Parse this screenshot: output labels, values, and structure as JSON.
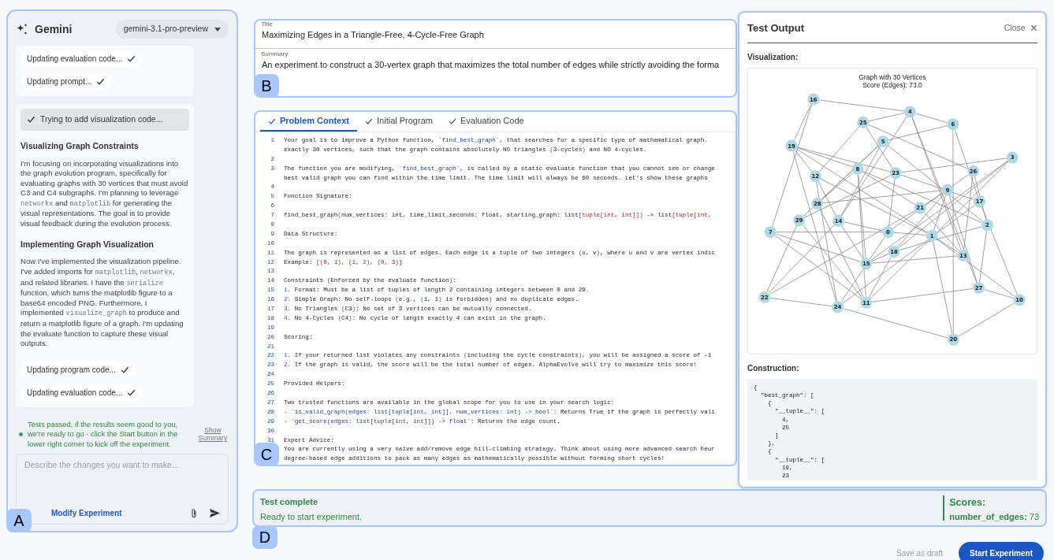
{
  "assistant": {
    "name": "Gemini",
    "model": "gemini-3.1-pro-preview",
    "messages": [
      {
        "kind": "steps",
        "items": [
          {
            "label": "Updating evaluation code...",
            "done": true
          },
          {
            "label": "Updating prompt...",
            "done": true
          }
        ]
      },
      {
        "kind": "thought",
        "status": {
          "label": "Trying to add visualization code...",
          "done": true
        },
        "sections": [
          {
            "heading": "Visualizing Graph Constraints",
            "body": [
              {
                "kind": "text",
                "text": "I'm focusing on incorporating visualizations into the graph evolution program, specifically for evaluating graphs with 30 vertices that must avoid C3 and C4 subgraphs. I'm planning to leverage "
              },
              {
                "kind": "code",
                "text": "networkx"
              },
              {
                "kind": "text",
                "text": " and "
              },
              {
                "kind": "code",
                "text": "matplotlib"
              },
              {
                "kind": "text",
                "text": " for generating the visual representations. The goal is to provide visual feedback during the evolution process."
              }
            ]
          },
          {
            "heading": "Implementing Graph Visualization",
            "body": [
              {
                "kind": "text",
                "text": "Now I've implemented the visualization pipeline. I've added imports for "
              },
              {
                "kind": "code",
                "text": "matplotlib"
              },
              {
                "kind": "text",
                "text": ", "
              },
              {
                "kind": "code",
                "text": "networkx"
              },
              {
                "kind": "text",
                "text": ", and related libraries. I have the "
              },
              {
                "kind": "code",
                "text": "serialize"
              },
              {
                "kind": "text",
                "text": " function, which turns the matplotlib figure to a base64 encoded PNG. Furthermore, I implemented "
              },
              {
                "kind": "code",
                "text": "visualize_graph"
              },
              {
                "kind": "text",
                "text": " to produce and return a matplotlib figure of a graph. I'm updating the evaluate function to capture these visual outputs."
              }
            ]
          }
        ],
        "items": [
          {
            "label": "Updating program code...",
            "done": true
          },
          {
            "label": "Updating evaluation code...",
            "done": true
          }
        ]
      }
    ],
    "notice": {
      "text": "Tests passed, if the results seem good to you, we're ready to go - click the Start button in the lower right corner to kick off the experiment.",
      "link": "Show Summary"
    },
    "composer": {
      "placeholder": "Describe the changes you want to make...",
      "action": "Modify Experiment"
    }
  },
  "experiment": {
    "title_label": "Title",
    "title": "Maximizing Edges in a Triangle-Free, 4-Cycle-Free Graph",
    "summary_label": "Summary",
    "summary": "An experiment to construct a 30-vertex graph that maximizes the total number of edges while strictly avoiding the forma"
  },
  "tabs": [
    {
      "label": "Problem Context",
      "selected": true,
      "done": true
    },
    {
      "label": "Initial Program",
      "selected": false,
      "done": true
    },
    {
      "label": "Evaluation Code",
      "selected": false,
      "done": true
    }
  ],
  "code_lines": [
    {
      "number": "1",
      "text": "Your goal is to improve a Python function, `find_best_graph`, that searches for a specific type of mathematical graph."
    },
    {
      "text": "exactly 30 vertices, such that the graph contains absolutely NO triangles (3-cycles) and NO 4-cycles."
    },
    {
      "number": "2"
    },
    {
      "number": "3",
      "text": "The function you are modifying, `find_best_graph`, is called by a static evaluate function that you cannot see or change"
    },
    {
      "text": "best valid graph you can find within the time limit. The time limit will always be 60 seconds. Let's show these graphs"
    },
    {
      "number": "4"
    },
    {
      "number": "5",
      "text": "Function Signature:"
    },
    {
      "number": "6"
    },
    {
      "number": "7",
      "text": "find_best_graph(num_vertices: int, time_limit_seconds: float, starting_graph: list[tuple[int, int]]) -> list[tuple[int,"
    },
    {
      "number": "8"
    },
    {
      "number": "9",
      "text": "Data Structure:"
    },
    {
      "number": "10"
    },
    {
      "number": "11",
      "text": "The graph is represented as a list of edges. Each edge is a tuple of two integers (u, v), where u and v are vertex indic"
    },
    {
      "number": "12",
      "text": "Example: [(0, 1), (1, 2), (0, 3)]"
    },
    {
      "number": "13"
    },
    {
      "number": "14",
      "text": "Constraints (Enforced by the evaluate function):"
    },
    {
      "number": "15",
      "text": "1. Format: Must be a list of tuples of length 2 containing integers between 0 and 29."
    },
    {
      "number": "16",
      "text": "2. Simple Graph: No self-loops (e.g., (1, 1) is forbidden) and no duplicate edges."
    },
    {
      "number": "17",
      "text": "3. No Triangles (C3): No set of 3 vertices can be mutually connected."
    },
    {
      "number": "18",
      "text": "4. No 4-Cycles (C4): No cycle of length exactly 4 can exist in the graph."
    },
    {
      "number": "19"
    },
    {
      "number": "20",
      "text": "Scoring:"
    },
    {
      "number": "21"
    },
    {
      "number": "22",
      "text": "1. If your returned list violates any constraints (including the cycle constraints), you will be assigned a score of -1"
    },
    {
      "number": "23",
      "text": "2. If the graph is valid, the score will be the total number of edges. AlphaEvolve will try to maximize this score!"
    },
    {
      "number": "24"
    },
    {
      "number": "25",
      "text": "Provided Helpers:"
    },
    {
      "number": "26"
    },
    {
      "number": "27",
      "text": "Two trusted functions are available in the global scope for you to use in your search logic:"
    },
    {
      "number": "28",
      "text": "- `is_valid_graph(edges: list[tuple[int, int]], num_vertices: int) -> bool`: Returns True if the graph is perfectly vali"
    },
    {
      "number": "29",
      "text": "- `get_score(edges: list[tuple[int, int]]) -> float`: Returns the edge count."
    },
    {
      "number": "30"
    },
    {
      "number": "31",
      "text": "Expert Advice:"
    },
    {
      "text": "You are currently using a very naive add/remove edge hill-climbing strategy. Think about using more advanced search heur"
    },
    {
      "text": "degree-based edge additions to pack as many edges as mathematically possible without forming short cycles!"
    }
  ],
  "status": {
    "title": "Test complete",
    "message": "Ready to start experiment.",
    "scores_label": "Scores:",
    "scores": [
      {
        "name": "number_of_edges:",
        "value": "73"
      }
    ]
  },
  "test_output": {
    "title": "Test Output",
    "close": "Close",
    "close_icon": "×",
    "visualization_label": "Visualization:",
    "graph": {
      "title": "Graph with 30 Vertices",
      "subtitle": "Score (Edges): 73.0",
      "nodes": [
        "0",
        "1",
        "2",
        "3",
        "4",
        "5",
        "6",
        "7",
        "8",
        "9",
        "10",
        "11",
        "12",
        "13",
        "14",
        "15",
        "16",
        "17",
        "18",
        "19",
        "20",
        "21",
        "22",
        "23",
        "24",
        "25",
        "26",
        "27",
        "28",
        "29"
      ]
    },
    "construction_label": "Construction:",
    "construction": [
      "{",
      "  \"best_graph\": [",
      "    {",
      "      \"__tuple__\": [",
      "        4,",
      "        25",
      "      ]",
      "    },",
      "    {",
      "      \"__tuple__\": [",
      "        19,",
      "        23"
    ]
  },
  "footer": {
    "secondary": "Save as draft",
    "primary": "Start Experiment"
  },
  "annotations": [
    "A",
    "B",
    "C",
    "D"
  ]
}
